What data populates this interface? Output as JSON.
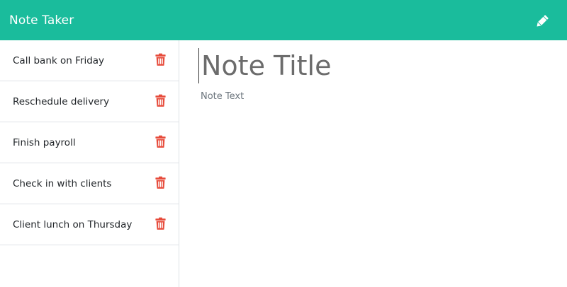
{
  "app": {
    "brand": "Note Taker",
    "accent_color": "#1abc9c",
    "danger_color": "#dc3545",
    "new_note_icon": "pencil-icon"
  },
  "sidebar": {
    "notes": [
      {
        "title": "Call bank on Friday",
        "delete_icon": "trash-icon"
      },
      {
        "title": "Reschedule delivery",
        "delete_icon": "trash-icon"
      },
      {
        "title": "Finish payroll",
        "delete_icon": "trash-icon"
      },
      {
        "title": "Check in with clients",
        "delete_icon": "trash-icon"
      },
      {
        "title": "Client lunch on Thursday",
        "delete_icon": "trash-icon"
      }
    ]
  },
  "editor": {
    "title_value": "",
    "title_placeholder": "Note Title",
    "text_value": "",
    "text_placeholder": "Note Text"
  }
}
